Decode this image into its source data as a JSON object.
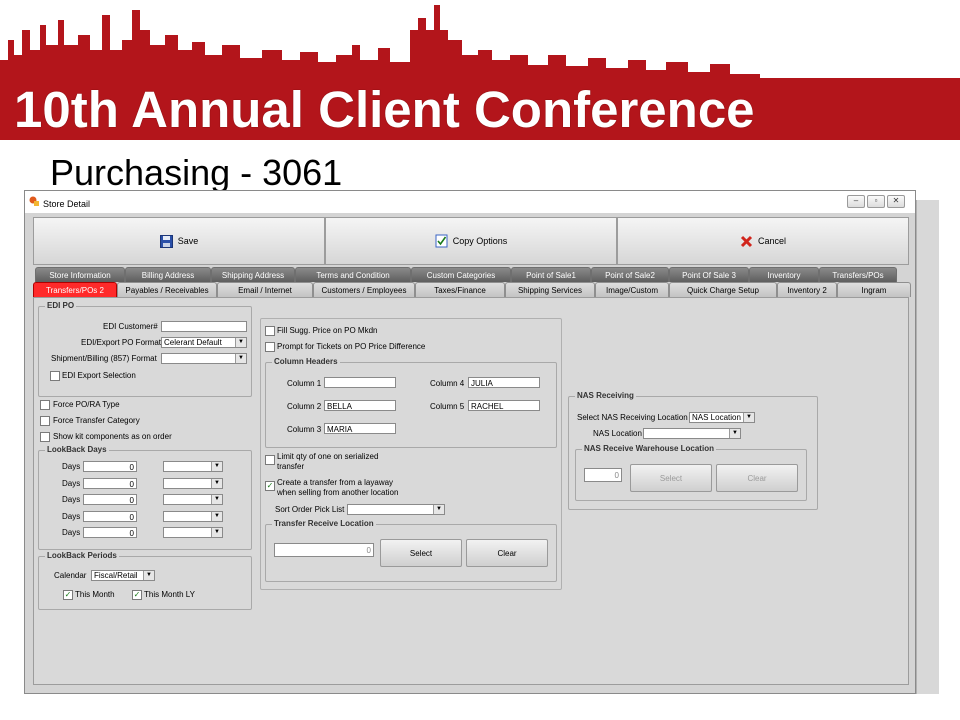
{
  "banner": {
    "title": "10th Annual Client Conference"
  },
  "slide_title": "Purchasing - 3061",
  "window": {
    "title": "Store Detail"
  },
  "toolbar": {
    "save": "Save",
    "copy_options": "Copy Options",
    "cancel": "Cancel"
  },
  "tabs_row1": [
    "Store Information",
    "Billing Address",
    "Shipping Address",
    "Terms and Condition",
    "Custom Categories",
    "Point of Sale1",
    "Point of Sale2",
    "Point Of Sale 3",
    "Inventory",
    "Transfers/POs"
  ],
  "tabs_row2": [
    "Transfers/POs 2",
    "Payables / Receivables",
    "Email / Internet",
    "Customers / Employees",
    "Taxes/Finance",
    "Shipping Services",
    "Image/Custom",
    "Quick Charge Setup",
    "Inventory 2",
    "Ingram"
  ],
  "edi": {
    "title": "EDI PO",
    "customer_label": "EDI Customer#",
    "customer_value": "",
    "export_format_label": "EDI/Export PO Format",
    "export_format_value": "Celerant Default",
    "shipment_label": "Shipment/Billing (857) Format",
    "shipment_value": "",
    "export_selection_label": "EDI Export Selection"
  },
  "left_checks": [
    "Force PO/RA Type",
    "Force Transfer Category",
    "Show kit components as on order"
  ],
  "lookback_days": {
    "title": "LookBack Days",
    "label": "Days",
    "values": [
      "0",
      "0",
      "0",
      "0",
      "0"
    ]
  },
  "lookback_periods": {
    "title": "LookBack Periods",
    "calendar_label": "Calendar",
    "calendar_value": "Fiscal/Retail",
    "this_month": "This Month",
    "this_month_ly": "This Month LY"
  },
  "middle": {
    "fill_sugg": "Fill Sugg. Price on PO Mkdn",
    "prompt_tickets": "Prompt for Tickets on PO Price Difference",
    "column_headers_title": "Column Headers",
    "columns": [
      {
        "label": "Column 1",
        "value": ""
      },
      {
        "label": "Column 2",
        "value": "BELLA"
      },
      {
        "label": "Column 3",
        "value": "MARIA"
      },
      {
        "label": "Column 4",
        "value": "JULIA"
      },
      {
        "label": "Column 5",
        "value": "RACHEL"
      }
    ],
    "limit_qty_line1": "Limit qty of one on serialized",
    "limit_qty_line2": "transfer",
    "create_transfer_line1": "Create a transfer from a layaway",
    "create_transfer_line2": "when selling from another location",
    "sort_order_label": "Sort Order Pick List",
    "sort_order_value": "",
    "transfer_receive_title": "Transfer Receive Location",
    "transfer_receive_value": "0",
    "select": "Select",
    "clear": "Clear"
  },
  "nas": {
    "title": "NAS Receiving",
    "select_location_label": "Select NAS Receiving Location",
    "select_location_value": "NAS Location",
    "location_label": "NAS Location",
    "location_value": "",
    "warehouse_title": "NAS Receive Warehouse Location",
    "warehouse_value": "0",
    "select": "Select",
    "clear": "Clear"
  },
  "colors": {
    "banner_red": "#b3151b",
    "active_tab": "#ff2a2a",
    "check_green": "#1a7a1a"
  }
}
